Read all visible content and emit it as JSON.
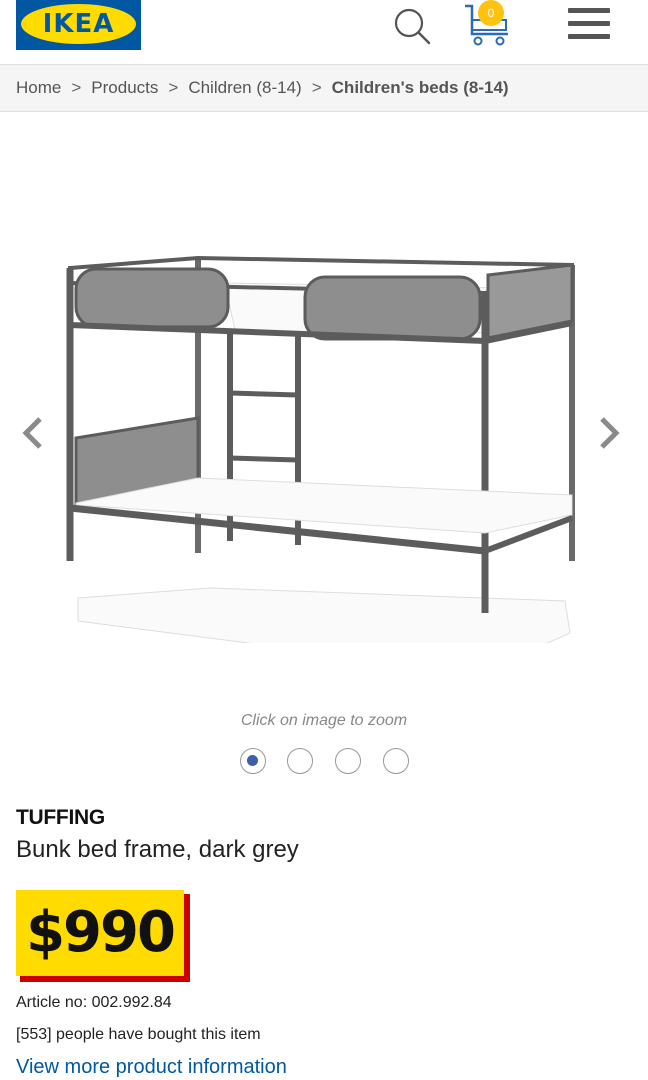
{
  "header": {
    "logo_text": "IKEA",
    "logo_reg": "®",
    "cart_count": "0",
    "brand_blue": "#0058a3",
    "brand_yellow": "#ffdb00",
    "icons": [
      "search-icon",
      "cart-icon",
      "menu-icon"
    ]
  },
  "breadcrumb": {
    "items": [
      "Home",
      "Products",
      "Children (8-14)",
      "Children's beds (8-14)"
    ],
    "separator": ">"
  },
  "gallery": {
    "zoom_hint": "Click on image to zoom",
    "image_count": 4,
    "active_index": 0
  },
  "product": {
    "name": "TUFFING",
    "description": "Bunk bed frame, dark grey",
    "price": "$990",
    "article": "Article no: 002.992.84",
    "bought": "[553] people have bought this item",
    "more_link": "View more product information"
  }
}
